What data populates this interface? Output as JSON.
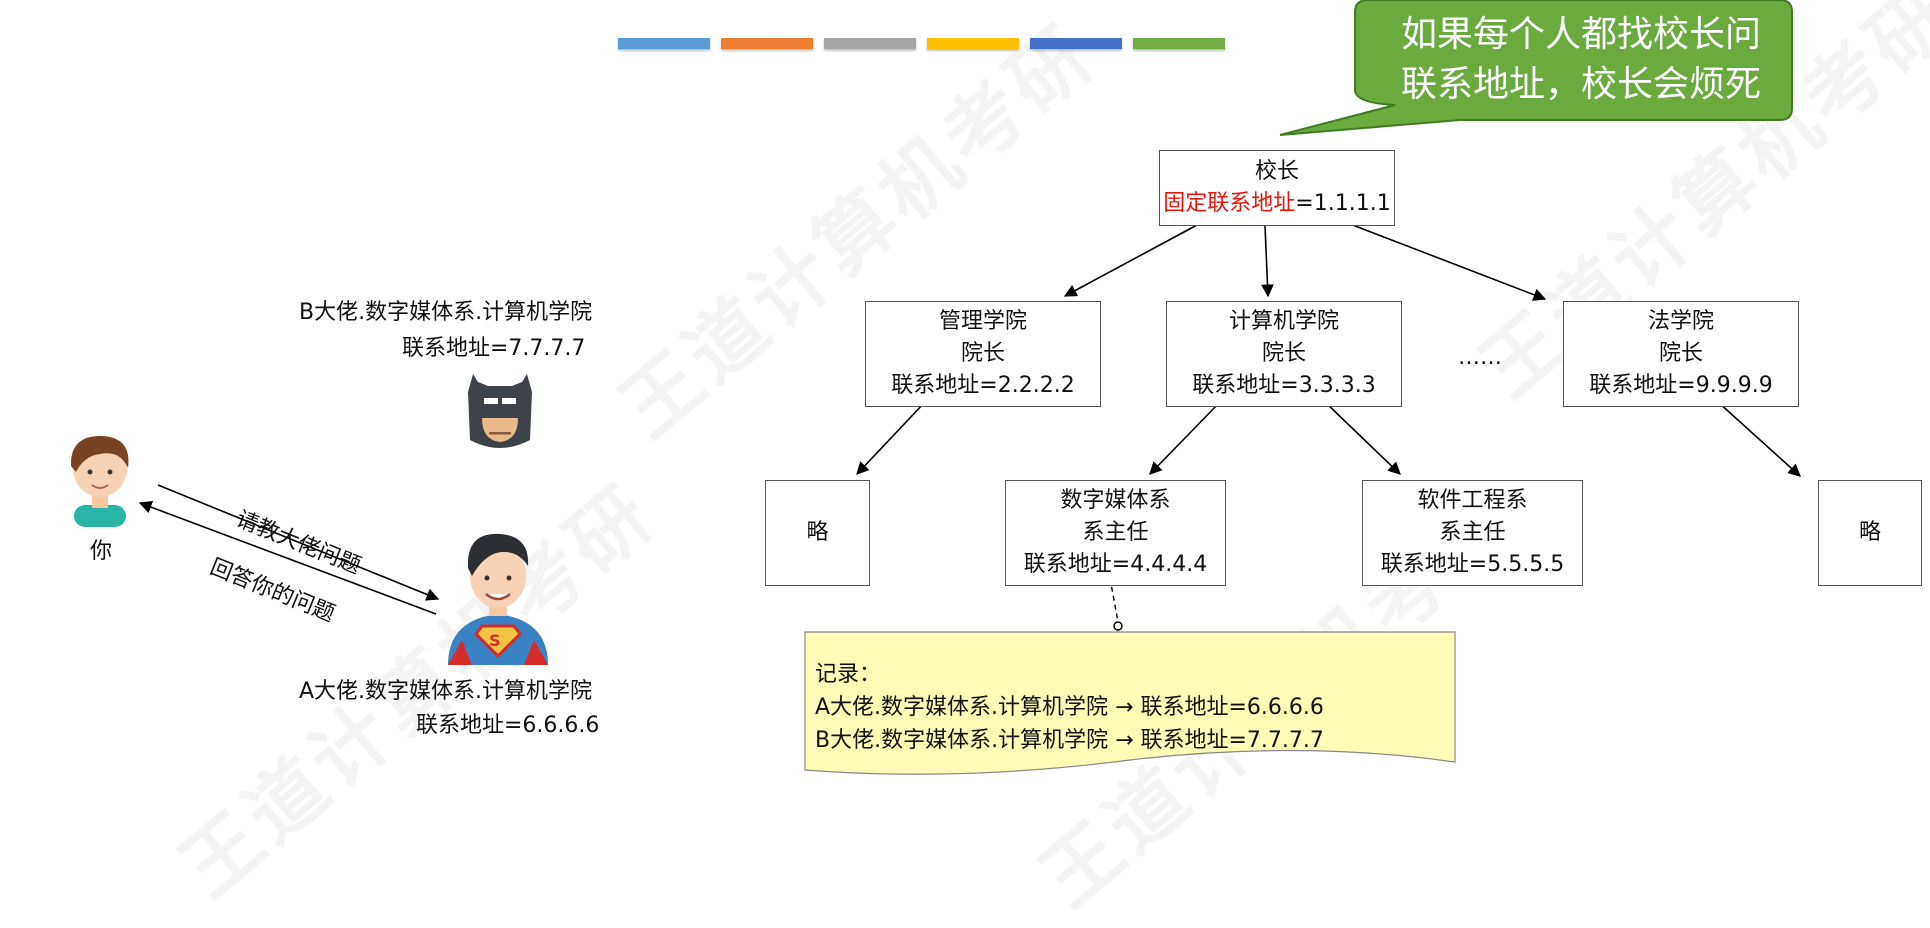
{
  "color_bars": [
    "#5b9bd5",
    "#ed7d31",
    "#a5a5a5",
    "#ffc000",
    "#4472c4",
    "#70ad47"
  ],
  "callout": {
    "line1": "如果每个人都找校长问",
    "line2": "联系地址，校长会烦死"
  },
  "principal": {
    "title": "校长",
    "addr_label": "固定联系地址",
    "addr_value": "=1.1.1.1"
  },
  "colleges": {
    "management": {
      "name": "管理学院",
      "role": "院长",
      "addr": "联系地址=2.2.2.2"
    },
    "computer": {
      "name": "计算机学院",
      "role": "院长",
      "addr": "联系地址=3.3.3.3"
    },
    "ellipsis": "……",
    "law": {
      "name": "法学院",
      "role": "院长",
      "addr": "联系地址=9.9.9.9"
    }
  },
  "departments": {
    "omitted_left": "略",
    "digital_media": {
      "name": "数字媒体系",
      "role": "系主任",
      "addr": "联系地址=4.4.4.4"
    },
    "software": {
      "name": "软件工程系",
      "role": "系主任",
      "addr": "联系地址=5.5.5.5"
    },
    "omitted_right": "略"
  },
  "note": {
    "heading": "记录：",
    "line1": "A大佬.数字媒体系.计算机学院 → 联系地址=6.6.6.6",
    "line2": "B大佬.数字媒体系.计算机学院 → 联系地址=7.7.7.7"
  },
  "persons": {
    "you": "你",
    "b": {
      "name": "B大佬.数字媒体系.计算机学院",
      "addr": "联系地址=7.7.7.7"
    },
    "a": {
      "name": "A大佬.数字媒体系.计算机学院",
      "addr": "联系地址=6.6.6.6"
    }
  },
  "arrows": {
    "ask": "请教大佬问题",
    "answer": "回答你的问题"
  },
  "watermark": "王道计算机考研"
}
